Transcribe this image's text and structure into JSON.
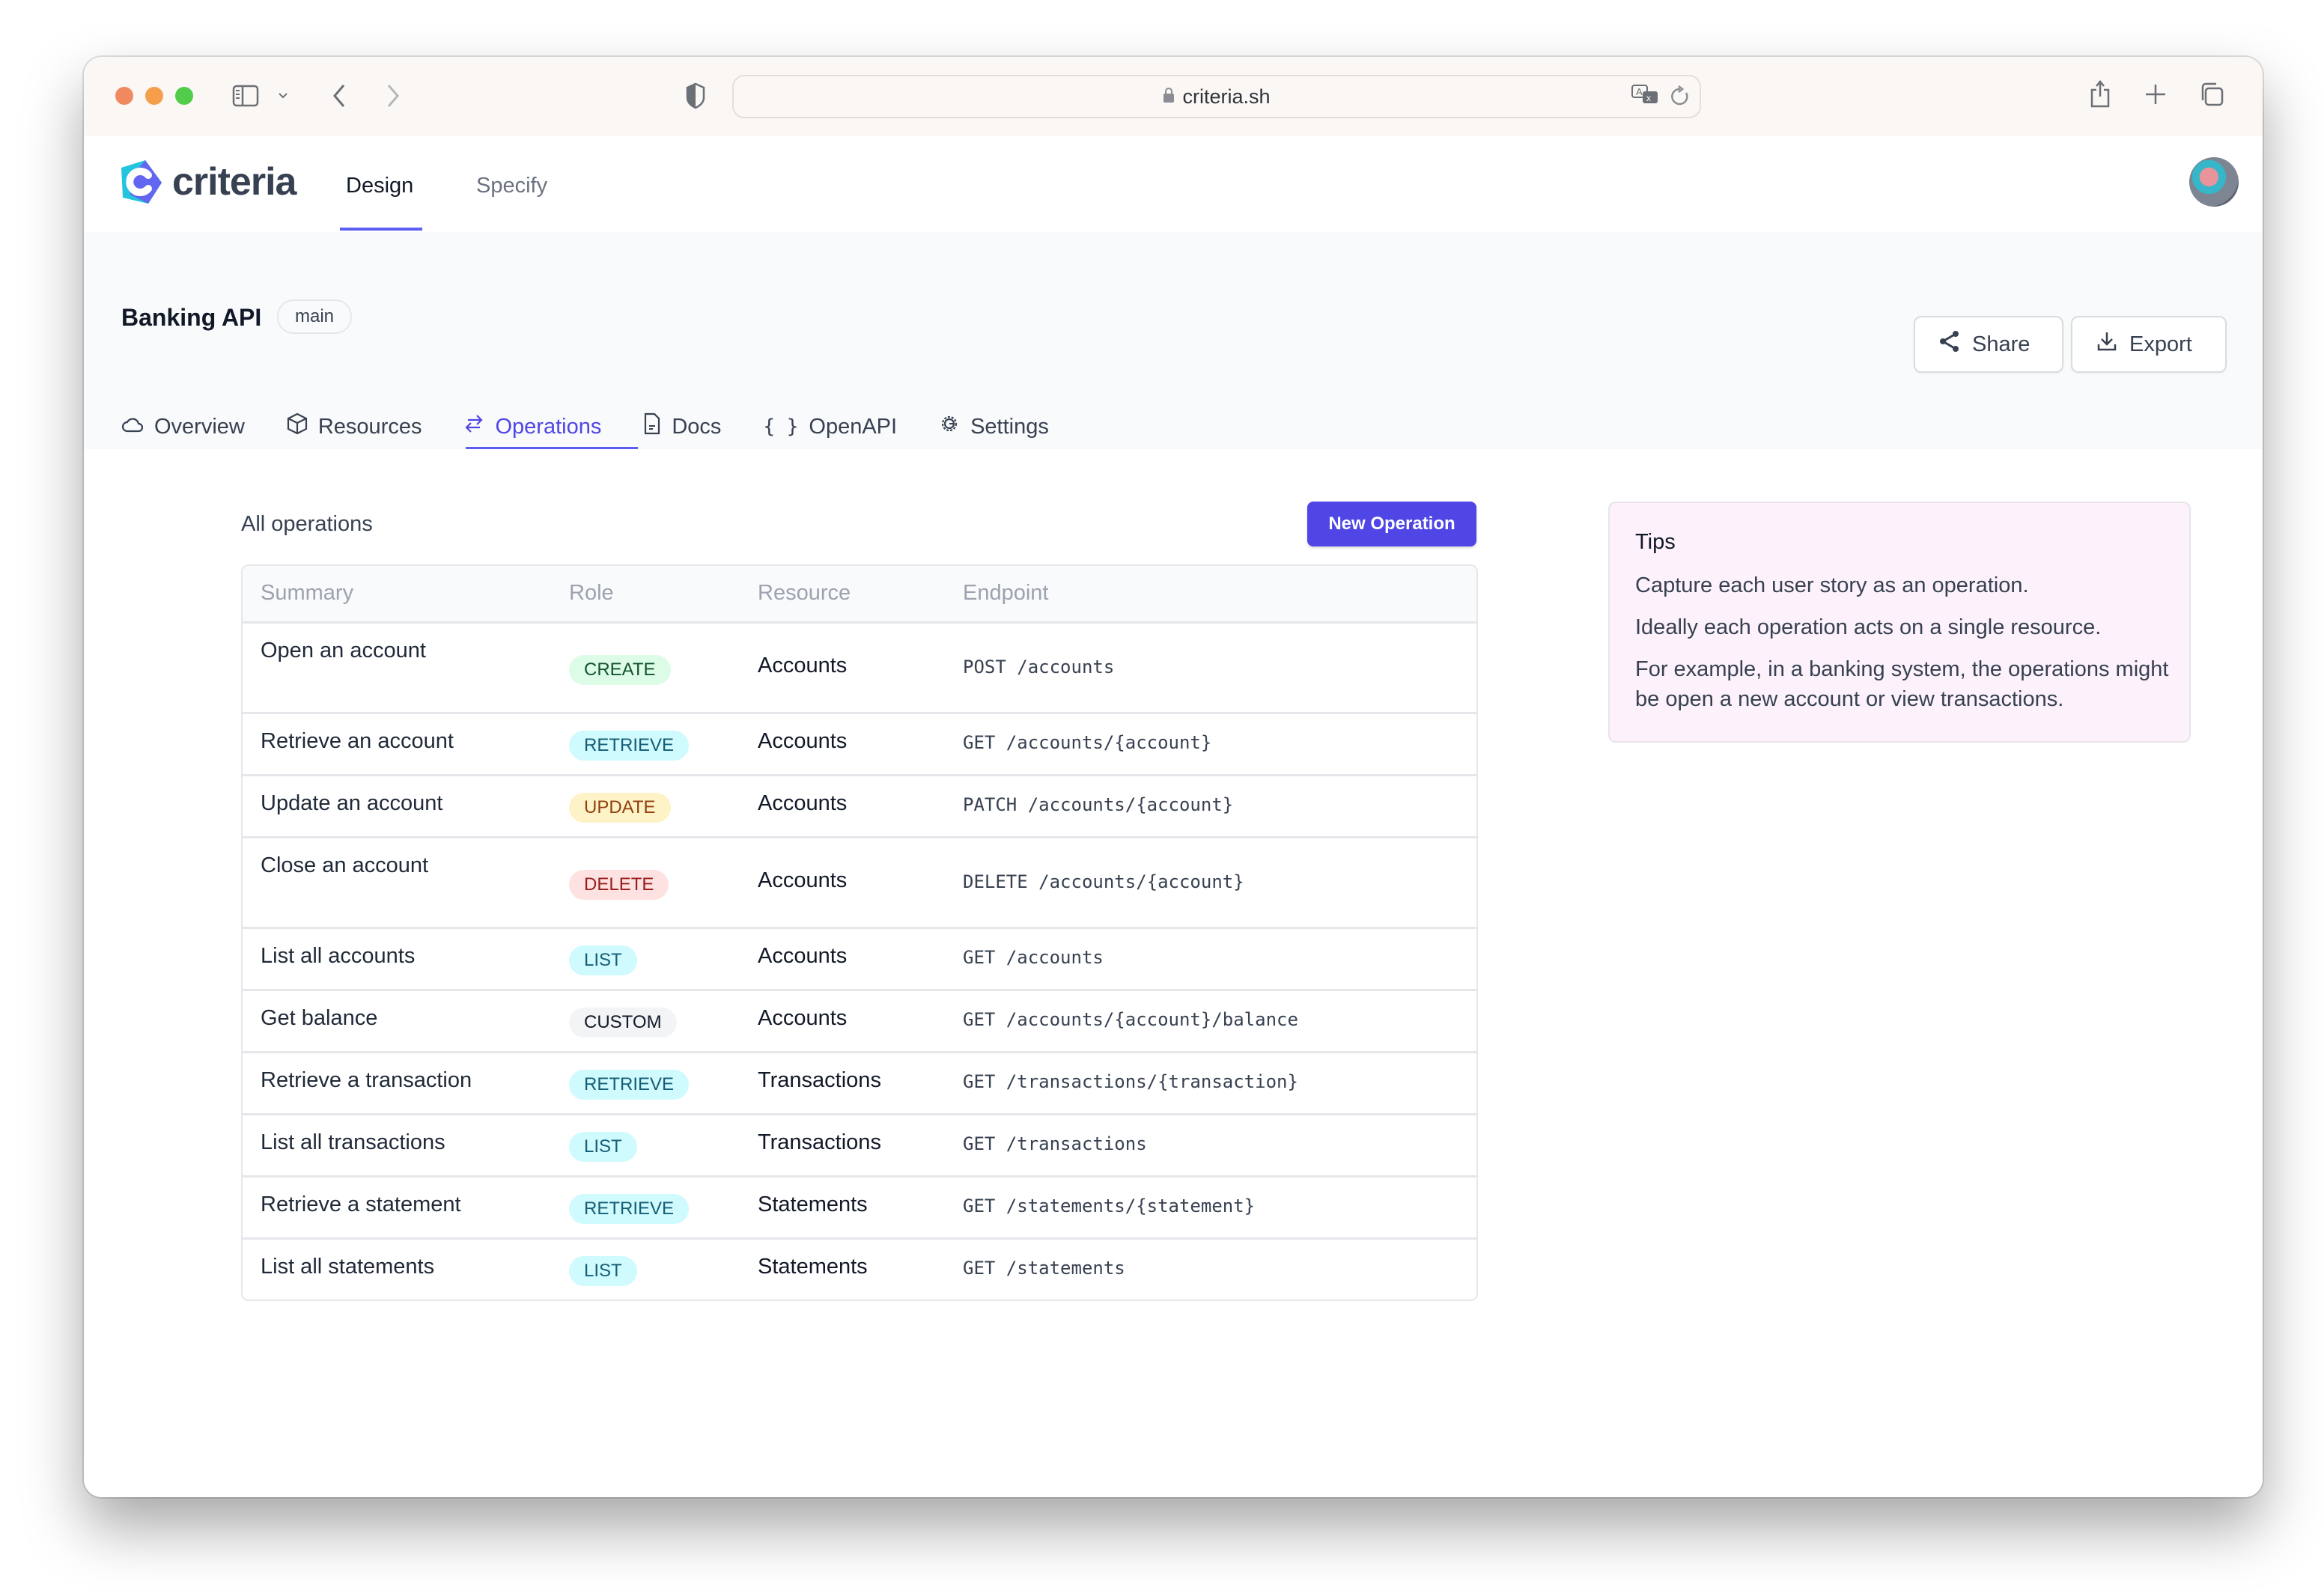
{
  "browser": {
    "url": "criteria.sh",
    "icons": [
      "sidebar-icon",
      "chevron-down-icon",
      "back-icon",
      "forward-icon",
      "shield-icon",
      "lock-icon",
      "translate-icon",
      "reload-icon",
      "share-icon",
      "new-tab-icon",
      "tabs-icon"
    ]
  },
  "app": {
    "logo_text": "criteria",
    "nav": [
      {
        "label": "Design",
        "active": true
      },
      {
        "label": "Specify",
        "active": false
      }
    ]
  },
  "project": {
    "title": "Banking API",
    "branch": "main",
    "share_label": "Share",
    "export_label": "Export",
    "tabs": [
      {
        "label": "Overview",
        "icon": "cloud-icon",
        "active": false
      },
      {
        "label": "Resources",
        "icon": "cube-icon",
        "active": false
      },
      {
        "label": "Operations",
        "icon": "arrows-exchange-icon",
        "active": true
      },
      {
        "label": "Docs",
        "icon": "document-icon",
        "active": false
      },
      {
        "label": "OpenAPI",
        "icon": "braces-icon",
        "active": false
      },
      {
        "label": "Settings",
        "icon": "gear-icon",
        "active": false
      }
    ]
  },
  "operations": {
    "title": "All operations",
    "new_button": "New Operation",
    "columns": [
      "Summary",
      "Role",
      "Resource",
      "Endpoint"
    ],
    "rows": [
      {
        "summary": "Open an account",
        "role": "CREATE",
        "resource": "Accounts",
        "endpoint": "POST /accounts"
      },
      {
        "summary": "Retrieve an account",
        "role": "RETRIEVE",
        "resource": "Accounts",
        "endpoint": "GET /accounts/{account}"
      },
      {
        "summary": "Update an account",
        "role": "UPDATE",
        "resource": "Accounts",
        "endpoint": "PATCH /accounts/{account}"
      },
      {
        "summary": "Close an account",
        "role": "DELETE",
        "resource": "Accounts",
        "endpoint": "DELETE /accounts/{account}"
      },
      {
        "summary": "List all accounts",
        "role": "LIST",
        "resource": "Accounts",
        "endpoint": "GET /accounts"
      },
      {
        "summary": "Get balance",
        "role": "CUSTOM",
        "resource": "Accounts",
        "endpoint": "GET /accounts/{account}/balance"
      },
      {
        "summary": "Retrieve a transaction",
        "role": "RETRIEVE",
        "resource": "Transactions",
        "endpoint": "GET /transactions/{transaction}"
      },
      {
        "summary": "List all transactions",
        "role": "LIST",
        "resource": "Transactions",
        "endpoint": "GET /transactions"
      },
      {
        "summary": "Retrieve a statement",
        "role": "RETRIEVE",
        "resource": "Statements",
        "endpoint": "GET /statements/{statement}"
      },
      {
        "summary": "List all statements",
        "role": "LIST",
        "resource": "Statements",
        "endpoint": "GET /statements"
      }
    ],
    "role_colors": {
      "CREATE": {
        "bg": "#dcfce7",
        "fg": "#14532d"
      },
      "RETRIEVE": {
        "bg": "#cffafe",
        "fg": "#155e75"
      },
      "UPDATE": {
        "bg": "#fef3c7",
        "fg": "#92400e"
      },
      "DELETE": {
        "bg": "#fee2e2",
        "fg": "#991b1b"
      },
      "LIST": {
        "bg": "#cffafe",
        "fg": "#155e75"
      },
      "CUSTOM": {
        "bg": "#f3f4f6",
        "fg": "#111827"
      }
    }
  },
  "tips": {
    "title": "Tips",
    "paragraphs": [
      "Capture each user story as an operation.",
      "Ideally each operation acts on a single resource.",
      "For example, in a banking system, the operations might be open a new account or view transactions."
    ]
  },
  "colors": {
    "accent": "#4f46e5",
    "tips_bg": "#fdf2fc"
  }
}
